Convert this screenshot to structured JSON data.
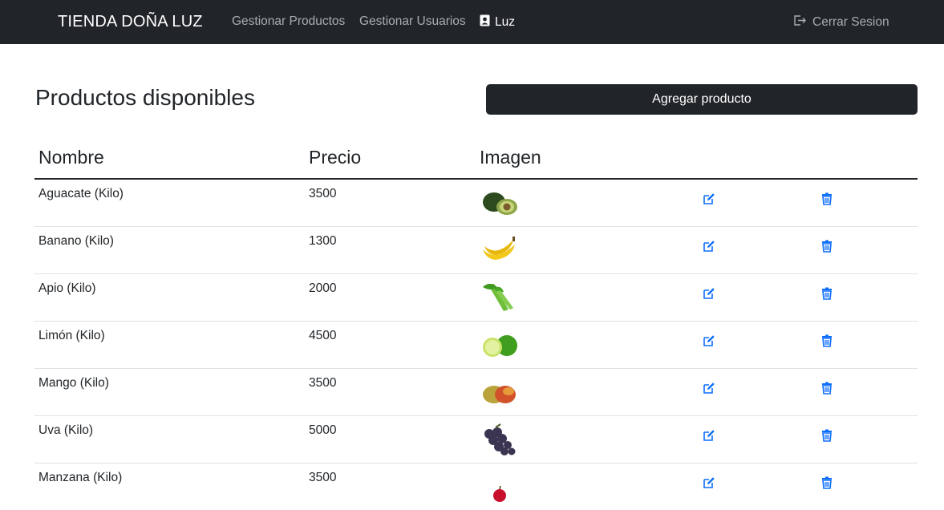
{
  "navbar": {
    "brand": "TIENDA DOÑA LUZ",
    "links": [
      "Gestionar Productos",
      "Gestionar Usuarios"
    ],
    "user": "Luz",
    "user_icon": "person-badge-icon",
    "logout": "Cerrar Sesion",
    "logout_icon": "box-arrow-right-icon"
  },
  "main": {
    "title": "Productos disponibles",
    "add_button": "Agregar producto"
  },
  "table": {
    "headers": [
      "Nombre",
      "Precio",
      "Imagen"
    ],
    "rows": [
      {
        "nombre": "Aguacate (Kilo)",
        "precio": "3500",
        "image_icon": "avocado-image"
      },
      {
        "nombre": "Banano (Kilo)",
        "precio": "1300",
        "image_icon": "banana-image"
      },
      {
        "nombre": "Apio (Kilo)",
        "precio": "2000",
        "image_icon": "celery-image"
      },
      {
        "nombre": "Limón (Kilo)",
        "precio": "4500",
        "image_icon": "lime-image"
      },
      {
        "nombre": "Mango (Kilo)",
        "precio": "3500",
        "image_icon": "mango-image"
      },
      {
        "nombre": "Uva (Kilo)",
        "precio": "5000",
        "image_icon": "grapes-image"
      },
      {
        "nombre": "Manzana (Kilo)",
        "precio": "3500",
        "image_icon": "apple-image"
      }
    ],
    "edit_icon": "pencil-square-icon",
    "delete_icon": "trash-icon"
  },
  "colors": {
    "navbar_bg": "#212529",
    "nav_link": "#a9acb0",
    "action_icon": "#0d6efd"
  }
}
